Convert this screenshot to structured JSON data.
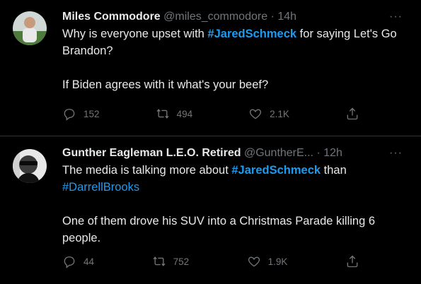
{
  "tweets": [
    {
      "name": "Miles Commodore",
      "handle": "@miles_commodore",
      "dot": "·",
      "time": "14h",
      "more": "···",
      "line1_pre": "Why is everyone upset with ",
      "line1_hashtag": "#JaredSchmeck",
      "line1_post": " for saying Let's Go Brandon?",
      "line2": "If Biden agrees with it what's your beef?",
      "replies": "152",
      "retweets": "494",
      "likes": "2.1K"
    },
    {
      "name": "Gunther Eagleman L.E.O. Retired",
      "handle": "@GuntherE...",
      "dot": "·",
      "time": "12h",
      "more": "···",
      "line1_pre": "The media is talking more about ",
      "line1_hashtag": "#JaredSchmeck",
      "line1_mid": " than ",
      "line1_hashtag2": "#DarrellBrooks",
      "line2": "One of them drove his SUV into a Christmas Parade killing 6 people.",
      "replies": "44",
      "retweets": "752",
      "likes": "1.9K"
    }
  ]
}
